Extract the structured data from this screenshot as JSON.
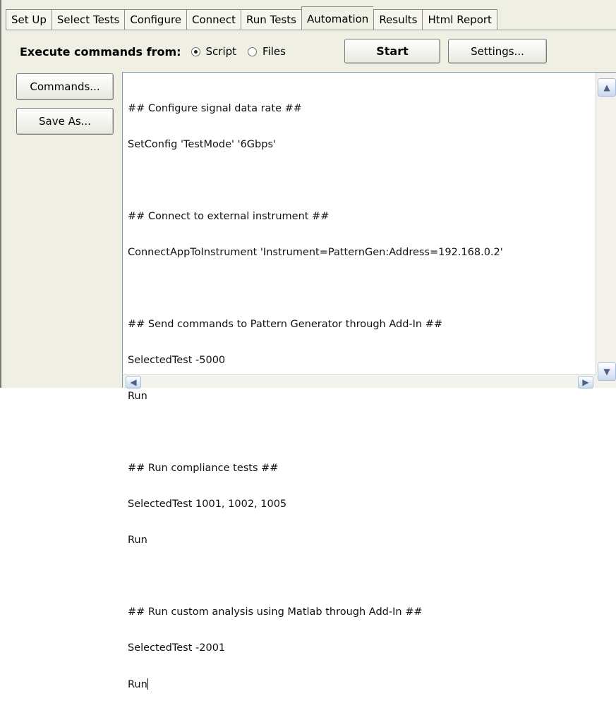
{
  "tabs": [
    {
      "label": "Set Up",
      "active": false
    },
    {
      "label": "Select Tests",
      "active": false
    },
    {
      "label": "Configure",
      "active": false
    },
    {
      "label": "Connect",
      "active": false
    },
    {
      "label": "Run Tests",
      "active": false
    },
    {
      "label": "Automation",
      "active": true
    },
    {
      "label": "Results",
      "active": false
    },
    {
      "label": "Html Report",
      "active": false
    }
  ],
  "execute": {
    "label": "Execute commands from:",
    "options": [
      {
        "label": "Script",
        "selected": true
      },
      {
        "label": "Files",
        "selected": false
      }
    ]
  },
  "buttons": {
    "start": "Start",
    "settings": "Settings...",
    "commands": "Commands...",
    "save_as": "Save As..."
  },
  "script": {
    "lines": [
      "## Configure signal data rate ##",
      "SetConfig 'TestMode' '6Gbps'",
      "",
      "## Connect to external instrument ##",
      "ConnectAppToInstrument 'Instrument=PatternGen:Address=192.168.0.2'",
      "",
      "## Send commands to Pattern Generator through Add-In ##",
      "SelectedTest -5000",
      "Run",
      "",
      "## Run compliance tests ##",
      "SelectedTest 1001, 1002, 1005",
      "Run",
      "",
      "## Run custom analysis using Matlab through Add-In ##",
      "SelectedTest -2001",
      "Run"
    ]
  },
  "icons": {
    "scroll_up": "▲",
    "scroll_down": "▼",
    "scroll_left": "◀",
    "scroll_right": "▶"
  }
}
